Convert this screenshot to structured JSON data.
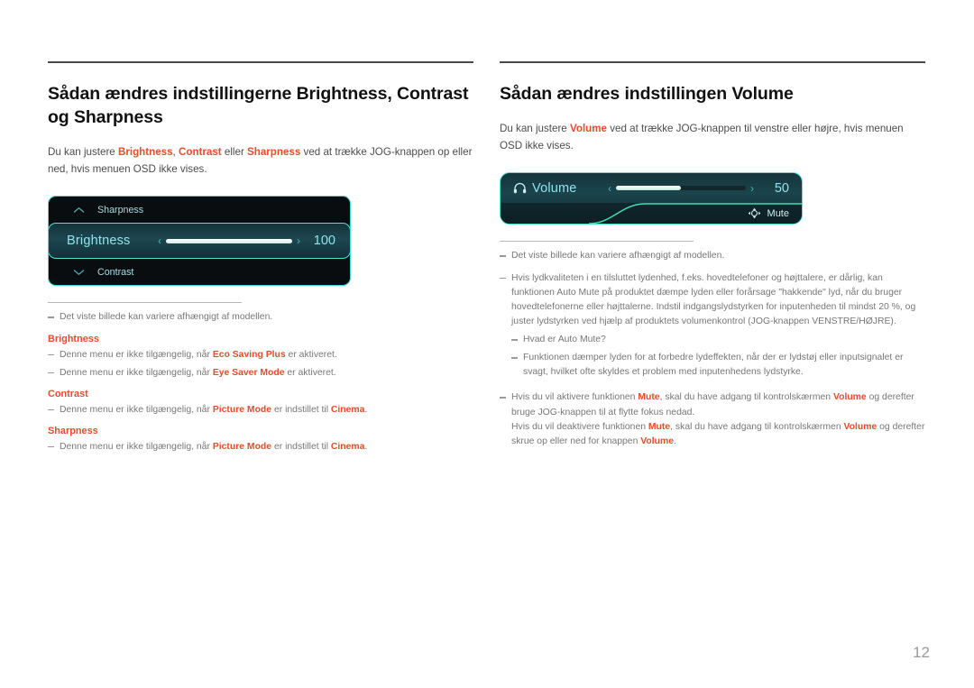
{
  "page": {
    "number": "12"
  },
  "left": {
    "heading": "Sådan ændres indstillingerne Brightness, Contrast og Sharpness",
    "intro": {
      "p1": "Du kan justere ",
      "t1": "Brightness",
      "p2": ", ",
      "t2": "Contrast",
      "p3": " eller ",
      "t3": "Sharpness",
      "p4": " ved at trække JOG-knappen op eller ned, hvis menuen OSD ikke vises."
    },
    "osd": {
      "top_item": "Sharpness",
      "top_icon": "chevron-up-icon",
      "selected_item": "Brightness",
      "selected_value": "100",
      "slider_percent": 100,
      "left_arrow": "‹",
      "right_arrow": "›",
      "bottom_item": "Contrast",
      "bottom_icon": "chevron-down-icon"
    },
    "notes": {
      "model": "Det viste billede kan variere afhængigt af modellen.",
      "brightness_head": "Brightness",
      "b1_a": "Denne menu er ikke tilgængelig, når ",
      "b1_t": "Eco Saving Plus",
      "b1_b": " er aktiveret.",
      "b2_a": "Denne menu er ikke tilgængelig, når ",
      "b2_t": "Eye Saver Mode",
      "b2_b": " er aktiveret.",
      "contrast_head": "Contrast",
      "c1_a": "Denne menu er ikke tilgængelig, når ",
      "c1_t1": "Picture Mode",
      "c1_b": " er indstillet til ",
      "c1_t2": "Cinema",
      "c1_c": ".",
      "sharpness_head": "Sharpness",
      "s1_a": "Denne menu er ikke tilgængelig, når ",
      "s1_t1": "Picture Mode",
      "s1_b": " er indstillet til ",
      "s1_t2": "Cinema",
      "s1_c": "."
    }
  },
  "right": {
    "heading": "Sådan ændres indstillingen Volume",
    "intro": {
      "p1": "Du kan justere ",
      "t1": "Volume",
      "p2": " ved at trække JOG-knappen til venstre eller højre, hvis menuen OSD ikke vises."
    },
    "osd": {
      "icon": "headphone-icon",
      "label": "Volume",
      "value": "50",
      "slider_percent": 50,
      "left_arrow": "‹",
      "right_arrow": "›",
      "mute_label": "Mute",
      "mute_icon": "dpad-icon"
    },
    "notes": {
      "model": "Det viste billede kan variere afhængigt af modellen.",
      "audio": "Hvis lydkvaliteten i en tilsluttet lydenhed, f.eks. hovedtelefoner og højttalere, er dårlig, kan funktionen Auto Mute på produktet dæmpe lyden eller forårsage \"hakkende\" lyd, når du bruger hovedtelefonerne eller højttalerne. Indstil indgangslydstyrken for inputenheden til mindst 20 %, og juster lydstyrken ved hjælp af produktets volumenkontrol (JOG-knappen VENSTRE/HØJRE).",
      "automute_q": "Hvad er Auto Mute?",
      "automute_a": "Funktionen dæmper lyden for at forbedre lydeffekten, når der er lydstøj eller inputsignalet er svagt, hvilket ofte skyldes et problem med inputenhedens lydstyrke.",
      "mute_on_a": "Hvis du vil aktivere funktionen ",
      "mute_on_t1": "Mute",
      "mute_on_b": ", skal du have adgang til kontrolskærmen ",
      "mute_on_t2": "Volume",
      "mute_on_c": " og derefter bruge JOG-knappen til at flytte fokus nedad.",
      "mute_off_a": "Hvis du vil deaktivere funktionen ",
      "mute_off_t1": "Mute",
      "mute_off_b": ", skal du have adgang til kontrolskærmen ",
      "mute_off_t2": "Volume",
      "mute_off_c": " og derefter skrue op eller ned for knappen ",
      "mute_off_t3": "Volume",
      "mute_off_d": "."
    }
  },
  "colors": {
    "accent_orange": "#eb4b26",
    "osd_cyan": "#49e4d8",
    "osd_text": "#8fe3ea",
    "rule_dark": "#4a4a4a"
  }
}
